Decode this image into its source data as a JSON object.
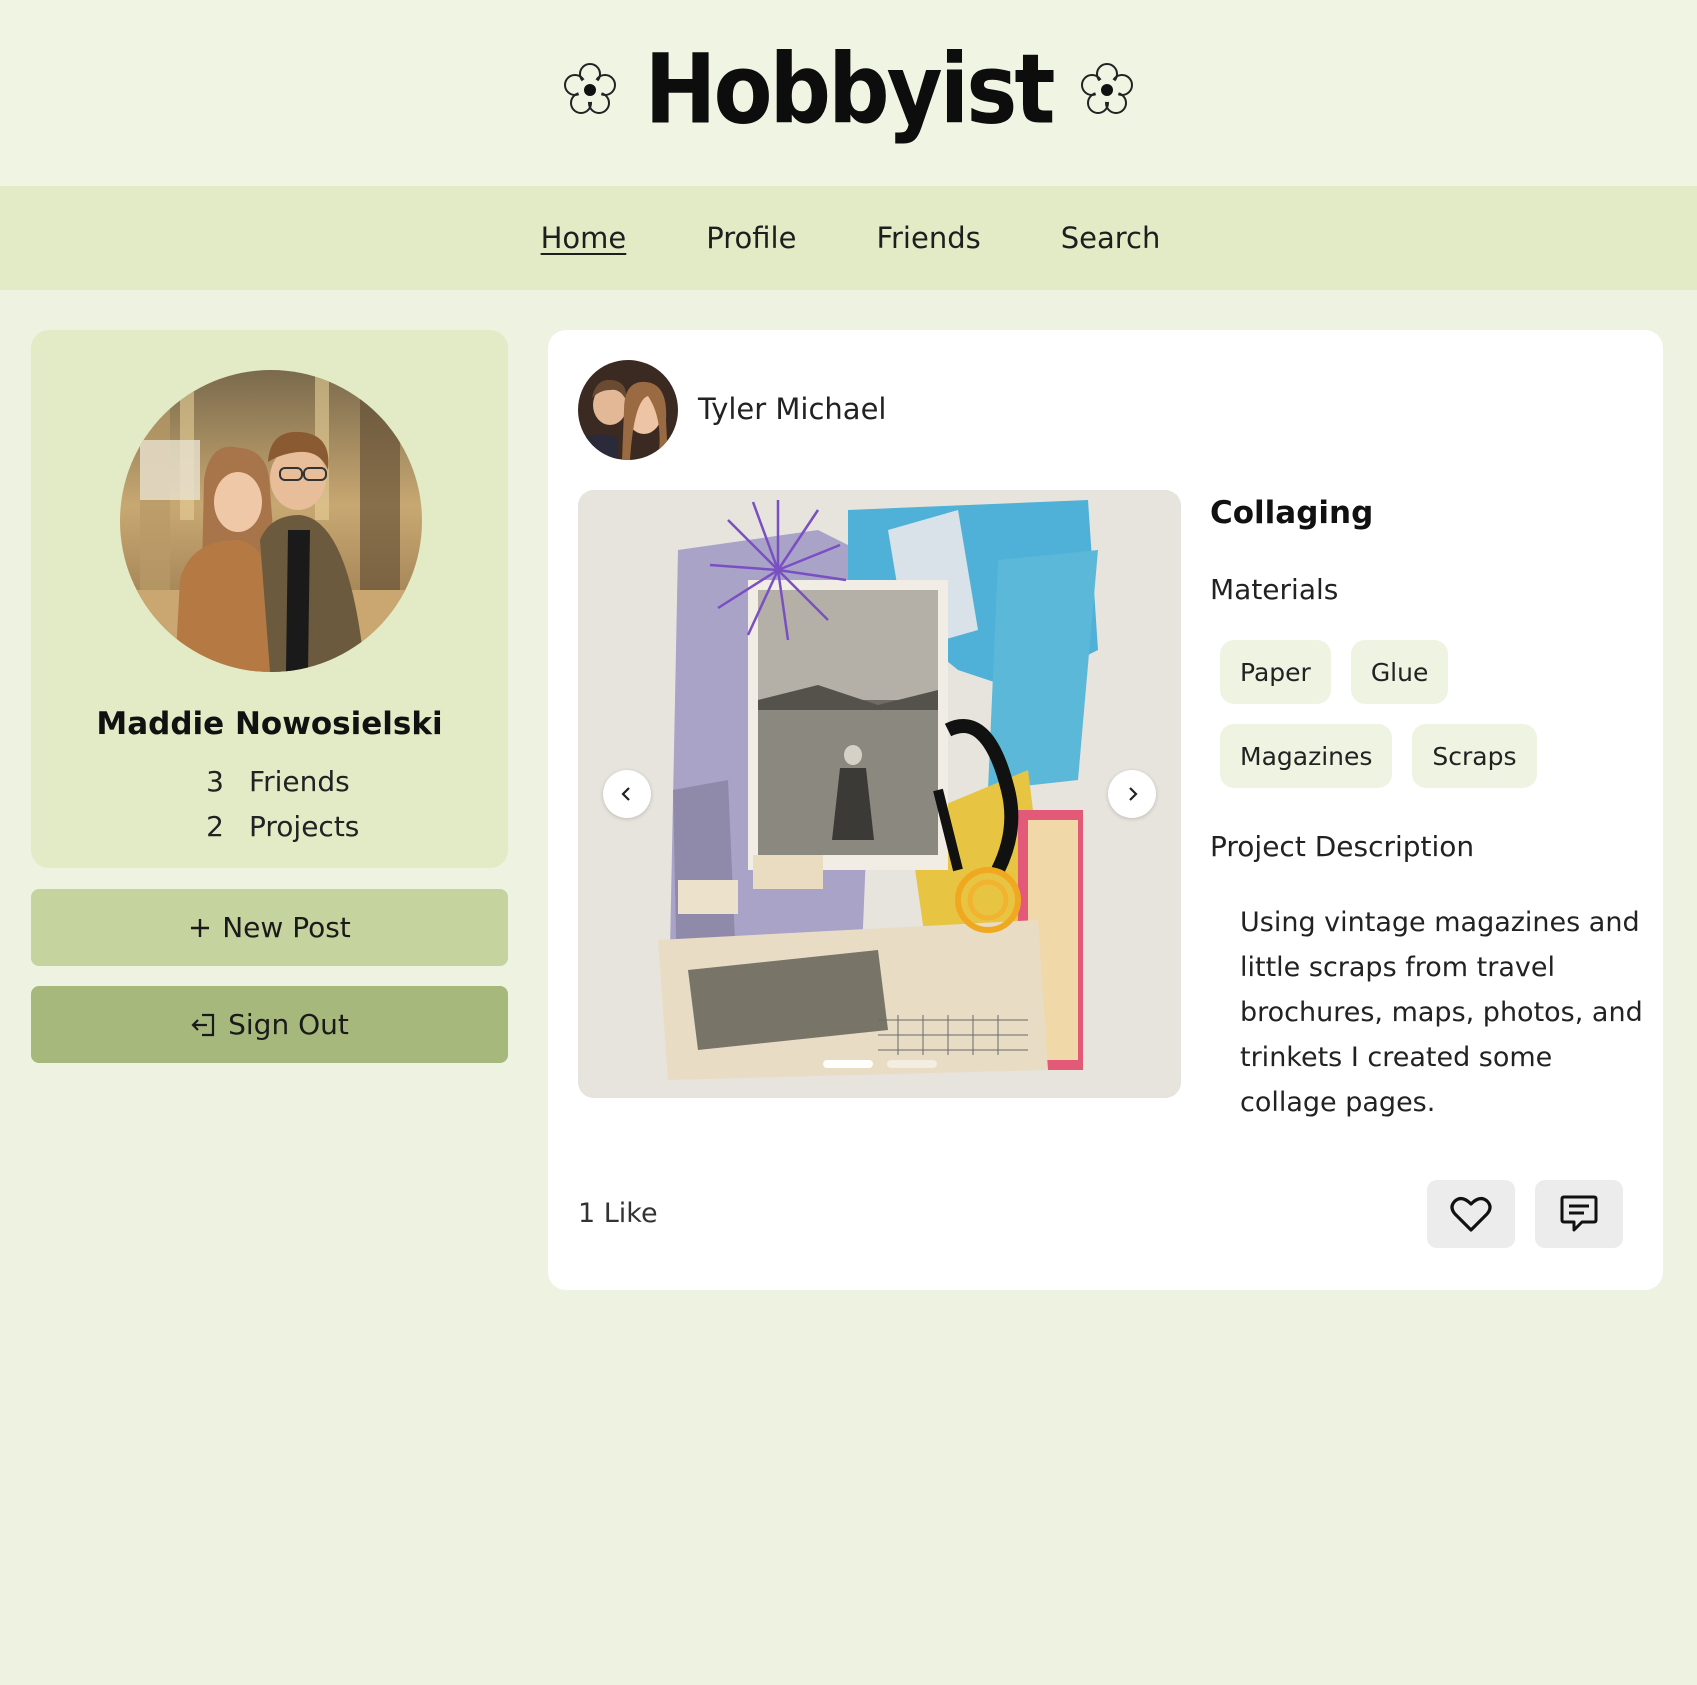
{
  "app": {
    "logo_text": "Hobbyist"
  },
  "nav": {
    "items": [
      {
        "label": "Home",
        "active": true
      },
      {
        "label": "Profile",
        "active": false
      },
      {
        "label": "Friends",
        "active": false
      },
      {
        "label": "Search",
        "active": false
      }
    ]
  },
  "profile": {
    "name": "Maddie Nowosielski",
    "stats": [
      {
        "count": "3",
        "label": "Friends"
      },
      {
        "count": "2",
        "label": "Projects"
      }
    ]
  },
  "actions": {
    "new_post": "New Post",
    "sign_out": "Sign Out"
  },
  "post": {
    "author": "Tyler Michael",
    "project_title": "Collaging",
    "materials_label": "Materials",
    "materials": [
      "Paper",
      "Glue",
      "Magazines",
      "Scraps"
    ],
    "description_label": "Project Description",
    "description": "Using vintage magazines and little scraps from travel brochures, maps, photos, and trinkets I created some collage pages.",
    "likes_text": "1 Like",
    "carousel": {
      "slide_count": 2,
      "active_slide": 1
    }
  },
  "colors": {
    "page_bg": "#eef3e1",
    "header_bg": "#f0f4e2",
    "nav_bg": "#e2eac6",
    "card_bg": "#e2eac6",
    "new_post_bg": "#c5d39f",
    "sign_out_bg": "#a6b87c",
    "tag_bg": "#eff3e1",
    "icon_btn_bg": "#ececec"
  }
}
